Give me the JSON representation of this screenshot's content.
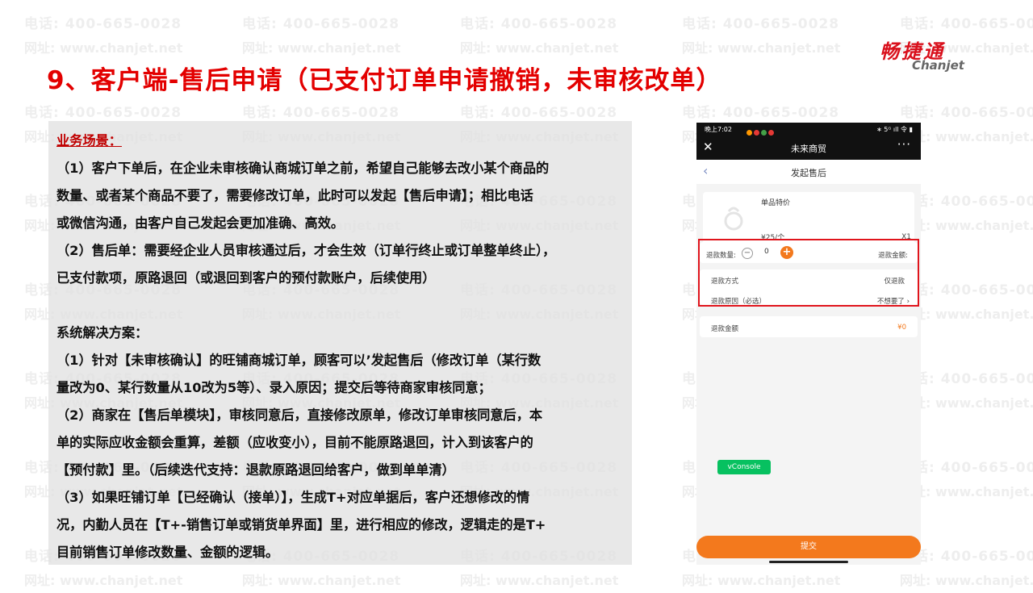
{
  "watermark": {
    "phone": "电话: 400-665-0028",
    "site": "网址: www.chanjet.net"
  },
  "slide_title": "9、客户端-售后申请（已支付订单申请撤销，未审核改单）",
  "logo": {
    "cn": "畅捷通",
    "en": "Chanjet"
  },
  "content": {
    "scenario_header": "业务场景：",
    "scenario_lines": [
      "（1）客户下单后，在企业未审核确认商城订单之前，希望自己能够去改小某个商品的",
      "数量、或者某个商品不要了，需要修改订单，此时可以发起【售后申请】；相比电话",
      "或微信沟通，由客户自己发起会更加准确、高效。",
      "（2）售后单：需要经企业人员审核通过后，才会生效（订单行终止或订单整单终止），",
      "已支付款项，原路退回（或退回到客户的预付款账户，后续使用）"
    ],
    "solution_header": "系统解决方案：",
    "solution_lines": [
      "（1）针对【未审核确认】的旺铺商城订单，顾客可以’发起售后（修改订单（某行数",
      "量改为0、某行数量从10改为5等）、录入原因；提交后等待商家审核同意；",
      "（2）商家在【售后单模块】，审核同意后，直接修改原单，修改订单审核同意后，本",
      "单的实际应收金额会重算，差额（应收变小），目前不能原路退回，计入到该客户的",
      "【预付款】里。（后续迭代支持：退款原路退回给客户，做到单单清）",
      "（3）如果旺铺订单【已经确认（接单）】，生成T+对应单据后，客户还想修改的情",
      "况，内勤人员在【T+-销售订单或销货单界面】里，进行相应的修改，逻辑走的是T+",
      "目前销售订单修改数量、金额的逻辑。"
    ]
  },
  "phone": {
    "status_time": "晚上7:02",
    "status_right": "∗ 5ᴳ ıll 令 ▮",
    "status_dot_colors": [
      "#ff9800",
      "#e53935",
      "#43a047",
      "#e53935"
    ],
    "app_title": "未来商贸",
    "close_icon": "✕",
    "more_icon": "···",
    "page_title": "发起售后",
    "back_icon": "‹",
    "product_name": "单品特价",
    "product_price": "¥25/个",
    "product_qty": "X1",
    "refund_qty_label": "退款数量:",
    "refund_qty_value": "0",
    "refund_amount_label": "退款金额:",
    "refund_method_label": "退款方式",
    "refund_method_value": "仅退款",
    "refund_reason_label": "退款原因（必选）",
    "refund_reason_value": "不想要了",
    "refund_total_label": "退款金额",
    "refund_total_value": "¥0",
    "vconsole_label": "vConsole",
    "submit_label": "提交",
    "accent_color": "#f3791d"
  }
}
